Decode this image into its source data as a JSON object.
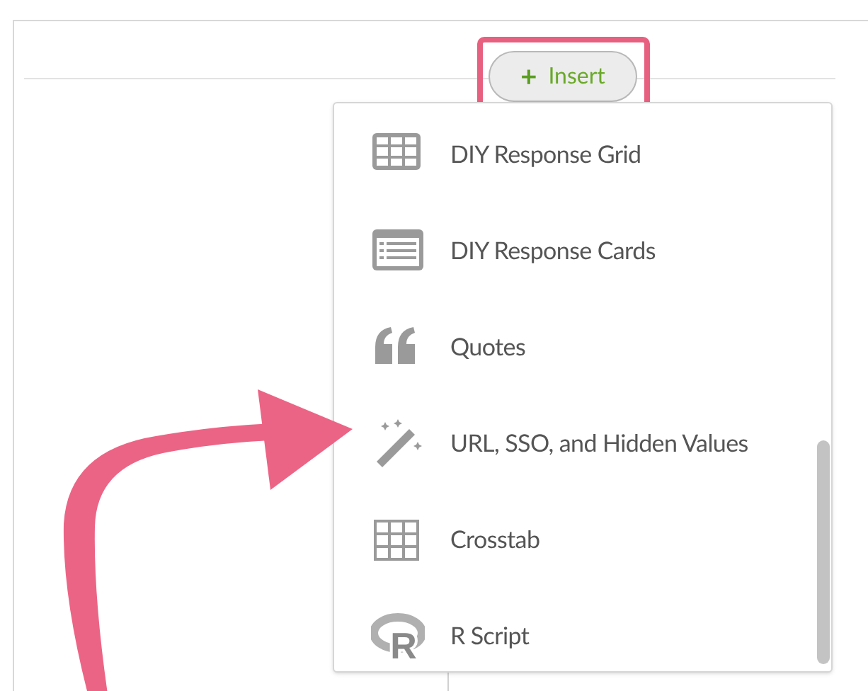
{
  "insert_button": {
    "label": "Insert",
    "icon": "+",
    "highlighted": true
  },
  "menu": {
    "items": [
      {
        "kind": "grid",
        "label": "DIY Response Grid"
      },
      {
        "kind": "cards",
        "label": "DIY Response Cards"
      },
      {
        "kind": "quotes",
        "label": "Quotes"
      },
      {
        "kind": "wand",
        "label": "URL, SSO, and Hidden Values"
      },
      {
        "kind": "crosstab",
        "label": "Crosstab"
      },
      {
        "kind": "r",
        "label": "R Script",
        "icon_letter": "R"
      }
    ]
  },
  "annotation_arrow": true
}
